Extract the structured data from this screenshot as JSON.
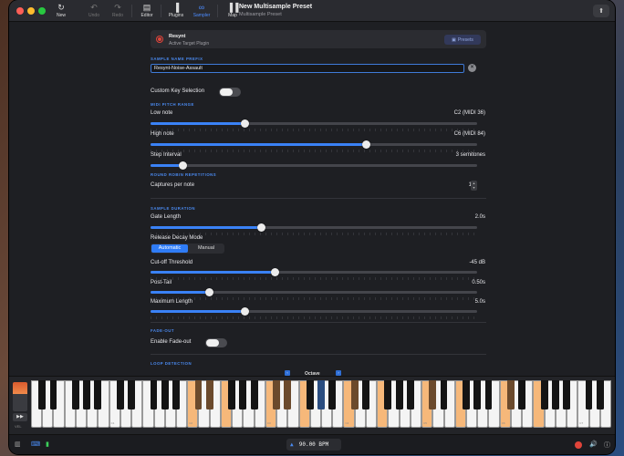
{
  "window": {
    "title": "New Multisample Preset",
    "subtitle": "Multisample Preset"
  },
  "toolbar": {
    "new": "New",
    "undo": "Undo",
    "redo": "Redo",
    "editor": "Editor",
    "plugins": "Plugins",
    "sampler": "Sampler",
    "map": "Map"
  },
  "plugin": {
    "name": "Resynt",
    "subtitle": "Active Target Plugin",
    "presets_label": "Presets"
  },
  "prefix": {
    "heading": "SAMPLE NAME PREFIX",
    "value": "Resynt-Noise-Assault"
  },
  "custom_key": {
    "label": "Custom Key Selection",
    "enabled": false
  },
  "pitch": {
    "heading": "MIDI PITCH RANGE",
    "low_label": "Low note",
    "low_value": "C2 (MIDI 36)",
    "low_fraction": 0.29,
    "high_label": "High note",
    "high_value": "C6 (MIDI 84)",
    "high_fraction": 0.66,
    "step_label": "Step Interval",
    "step_value": "3 semitones",
    "step_fraction": 0.1
  },
  "round_robin": {
    "heading": "ROUND ROBIN REPETITIONS",
    "label": "Captures per note",
    "value": "1x"
  },
  "duration": {
    "heading": "SAMPLE DURATION",
    "gate_label": "Gate Length",
    "gate_value": "2.0s",
    "gate_fraction": 0.34,
    "release_label": "Release Decay Mode",
    "mode_automatic": "Automatic",
    "mode_manual": "Manual",
    "cutoff_label": "Cut-off Threshold",
    "cutoff_value": "-45 dB",
    "cutoff_fraction": 0.38,
    "posttail_label": "Post-Tail",
    "posttail_value": "0.50s",
    "posttail_fraction": 0.18,
    "maxlen_label": "Maximum Length",
    "maxlen_value": "5.0s",
    "maxlen_fraction": 0.29
  },
  "fade": {
    "heading": "FADE-OUT",
    "label": "Enable Fade-out",
    "enabled": false
  },
  "loop": {
    "heading": "LOOP DETECTION"
  },
  "keyboard": {
    "octave_label": "Octave",
    "vel_label": "VEL",
    "c_labels": [
      "C1",
      "C2",
      "C3",
      "C4",
      "C5",
      "C6",
      "C7"
    ]
  },
  "status": {
    "tempo": "90.00 BPM"
  },
  "colors": {
    "accent": "#3a82f6",
    "record": "#e0443a",
    "key_highlight": "#f6b87a"
  }
}
